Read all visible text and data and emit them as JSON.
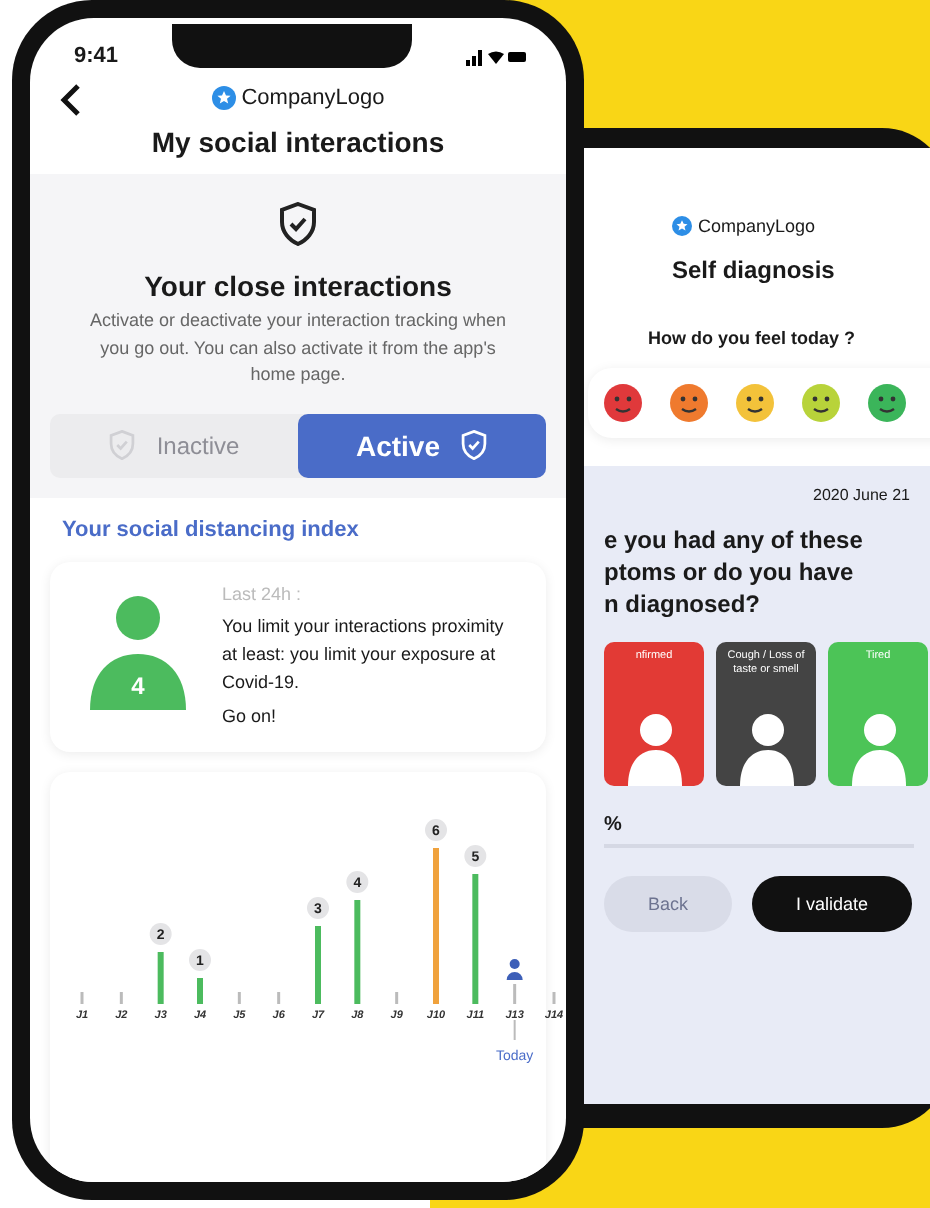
{
  "front_phone": {
    "status_bar": {
      "time": "9:41"
    },
    "logo": "CompanyLogo",
    "title": "My social interactions",
    "tracking": {
      "heading": "Your close interactions",
      "description": "Activate or deactivate your interaction tracking when you go out. You can also activate it from the app's home page.",
      "options": [
        {
          "label": "Inactive",
          "selected": false
        },
        {
          "label": "Active",
          "selected": true
        }
      ]
    },
    "index_heading": "Your social distancing index",
    "index_card": {
      "score": "4",
      "period": "Last 24h :",
      "message": "You limit your interactions proximity at least: you limit your exposure at Covid-19.",
      "cheer": "Go on!"
    },
    "chart_data": {
      "type": "bar",
      "categories": [
        "J1",
        "J2",
        "J3",
        "J4",
        "J5",
        "J6",
        "J7",
        "J8",
        "J9",
        "J10",
        "J11",
        "J13",
        "J14"
      ],
      "data_labels": true,
      "series": [
        {
          "color": "#4cbb5e",
          "values": [
            null,
            null,
            2,
            1,
            null,
            null,
            3,
            4,
            null,
            null,
            5,
            null,
            null
          ]
        },
        {
          "color": "#f0a23c",
          "values": [
            null,
            null,
            null,
            null,
            null,
            null,
            null,
            null,
            null,
            6,
            null,
            null,
            null
          ]
        }
      ]
    },
    "today_label": "Today"
  },
  "back_phone": {
    "logo": "CompanyLogo",
    "title": "Self diagnosis",
    "question": "How do you feel today ?",
    "moods": [
      {
        "color": "#e0393b"
      },
      {
        "color": "#ef7a2e"
      },
      {
        "color": "#f3c23a"
      },
      {
        "color": "#b8d33a"
      },
      {
        "color": "#3bb55a"
      }
    ],
    "date": "2020 June 21",
    "symptom_question": [
      "e you had any of these",
      "ptoms or do you have",
      "n diagnosed?"
    ],
    "symptoms": [
      {
        "label": "nfirmed",
        "color": "#e23a35"
      },
      {
        "label": "Cough / Loss of taste or smell",
        "color": "#444444"
      },
      {
        "label": "Tired",
        "color": "#4cc457"
      }
    ],
    "progress": {
      "label": "%"
    },
    "buttons": [
      {
        "label": "Back",
        "disabled": true
      },
      {
        "label": "I validate",
        "disabled": false
      }
    ]
  }
}
